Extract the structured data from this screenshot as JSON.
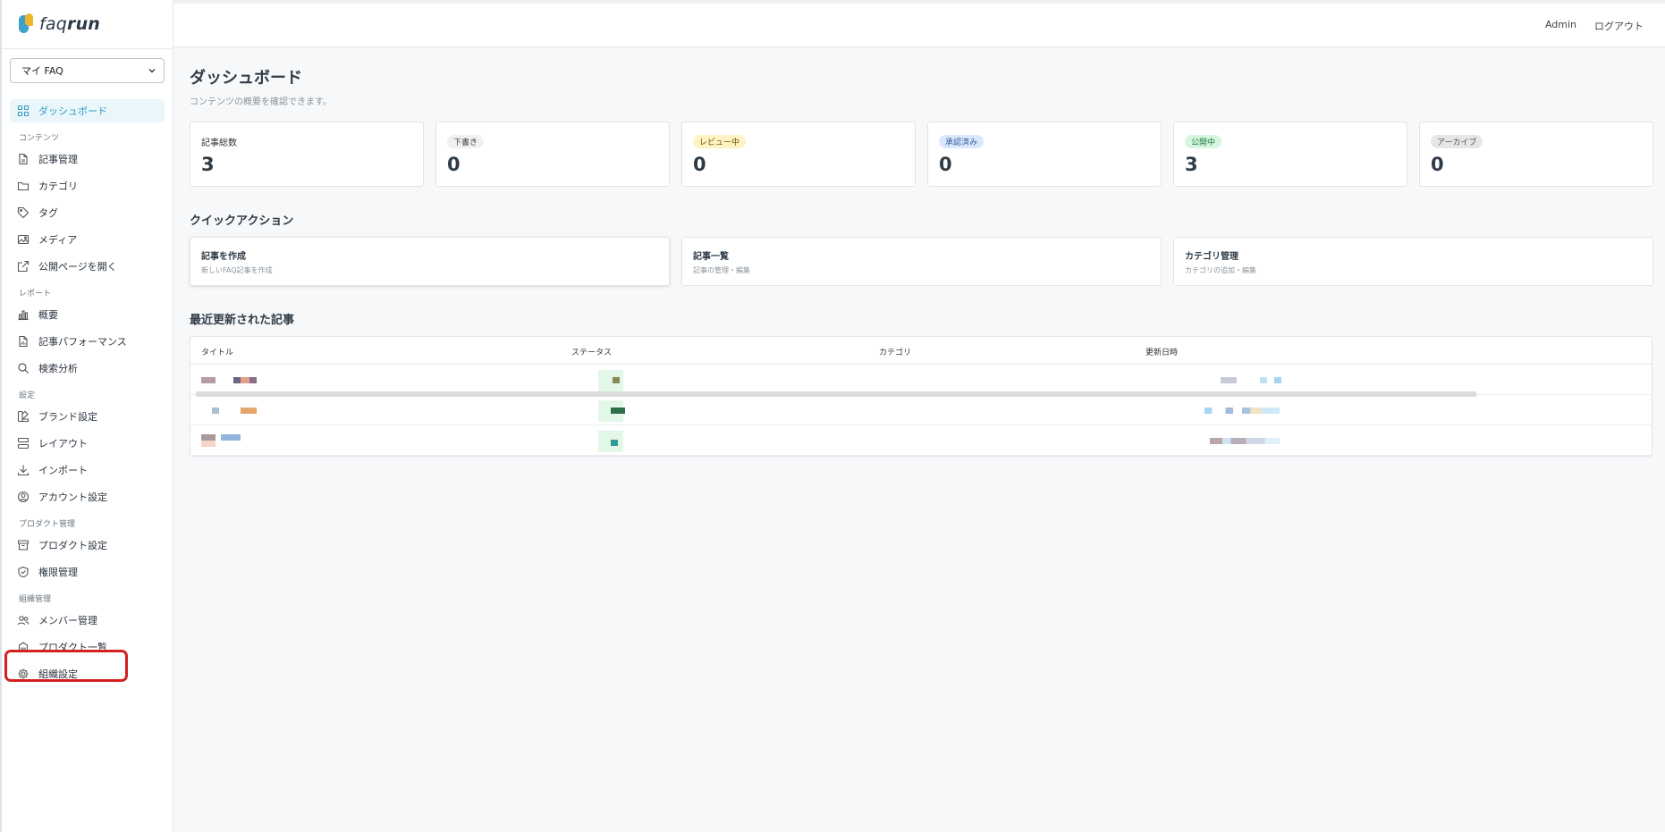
{
  "app": {
    "logo_prefix": "faq",
    "logo_suffix": "run",
    "product_select": "マイ FAQ"
  },
  "topbar": {
    "user": "Admin",
    "logout": "ログアウト"
  },
  "sidebar": {
    "dashboard": "ダッシュボード",
    "section_content": "コンテンツ",
    "articles": "記事管理",
    "categories": "カテゴリ",
    "tags": "タグ",
    "media": "メディア",
    "open_public": "公開ページを開く",
    "section_report": "レポート",
    "overview": "概要",
    "article_performance": "記事パフォーマンス",
    "search_analysis": "検索分析",
    "section_settings": "設定",
    "brand": "ブランド設定",
    "layout": "レイアウト",
    "import": "インポート",
    "account": "アカウント設定",
    "section_product": "プロダクト管理",
    "product_settings": "プロダクト設定",
    "permissions": "権限管理",
    "section_org": "組織管理",
    "members": "メンバー管理",
    "product_list": "プロダクト一覧",
    "org_settings": "組織設定"
  },
  "main": {
    "title": "ダッシュボード",
    "subtitle": "コンテンツの概要を確認できます。",
    "stats": [
      {
        "label": "記事総数",
        "value": "3"
      },
      {
        "label": "下書き",
        "value": "0"
      },
      {
        "label": "レビュー中",
        "value": "0"
      },
      {
        "label": "承認済み",
        "value": "0"
      },
      {
        "label": "公開中",
        "value": "3"
      },
      {
        "label": "アーカイブ",
        "value": "0"
      }
    ],
    "quick_title": "クイックアクション",
    "quick": [
      {
        "title": "記事を作成",
        "sub": "新しいFAQ記事を作成"
      },
      {
        "title": "記事一覧",
        "sub": "記事の管理・編集"
      },
      {
        "title": "カテゴリ管理",
        "sub": "カテゴリの追加・編集"
      }
    ],
    "recent_title": "最近更新された記事",
    "columns": {
      "title": "タイトル",
      "status": "ステータス",
      "category": "カテゴリ",
      "updated": "更新日時"
    }
  },
  "colors": {
    "accent": "#2a9cc2",
    "badge_review_bg": "#fdf3c4",
    "badge_approved_bg": "#dbe8fb",
    "badge_public_bg": "#d8f5e0",
    "badge_archive_bg": "#e6e6e6",
    "badge_draft_bg": "#f0f0f0",
    "highlight": "#d42020"
  }
}
